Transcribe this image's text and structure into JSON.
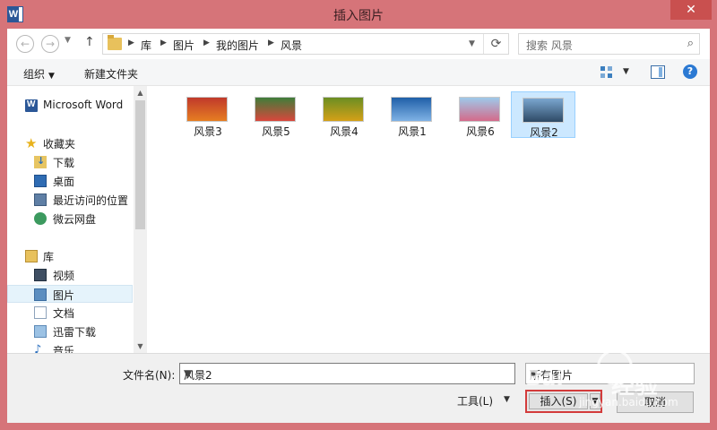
{
  "window": {
    "title": "插入图片",
    "close_glyph": "✕"
  },
  "nav": {
    "back_glyph": "←",
    "forward_glyph": "→",
    "up_glyph": "↑",
    "breadcrumbs": [
      "库",
      "图片",
      "我的图片",
      "风景"
    ],
    "refresh_glyph": "⟳",
    "search_placeholder": "搜索 风景",
    "search_glyph": "⌕"
  },
  "toolbar": {
    "organize_label": "组织",
    "new_folder_label": "新建文件夹",
    "help_glyph": "?"
  },
  "sidebar": {
    "items": [
      {
        "label": "Microsoft Word",
        "icon": "word-icon"
      },
      {
        "label": "收藏夹",
        "icon": "star-icon"
      },
      {
        "label": "下载",
        "icon": "downloads-icon"
      },
      {
        "label": "桌面",
        "icon": "desktop-icon"
      },
      {
        "label": "最近访问的位置",
        "icon": "recent-places-icon"
      },
      {
        "label": "微云网盘",
        "icon": "cloud-drive-icon"
      },
      {
        "label": "库",
        "icon": "library-icon"
      },
      {
        "label": "视频",
        "icon": "video-icon"
      },
      {
        "label": "图片",
        "icon": "pictures-icon",
        "selected": true
      },
      {
        "label": "文档",
        "icon": "documents-icon"
      },
      {
        "label": "迅雷下载",
        "icon": "thunder-download-icon"
      },
      {
        "label": "音乐",
        "icon": "music-icon"
      }
    ]
  },
  "files": [
    {
      "name": "风景3",
      "colors": [
        "#c0392b",
        "#e67e22"
      ]
    },
    {
      "name": "风景5",
      "colors": [
        "#3f7d3a",
        "#d9473c"
      ]
    },
    {
      "name": "风景4",
      "colors": [
        "#6b8e23",
        "#d4a017"
      ]
    },
    {
      "name": "风景1",
      "colors": [
        "#1f5fa8",
        "#7fb2e5"
      ]
    },
    {
      "name": "风景6",
      "colors": [
        "#9ec9ea",
        "#d46a8a"
      ]
    },
    {
      "name": "风景2",
      "colors": [
        "#7aa6cf",
        "#2e4a66"
      ],
      "selected": true
    }
  ],
  "footer": {
    "filename_label": "文件名(N):",
    "filename_value": "风景2",
    "filetype_value": "所有图片",
    "tools_label": "工具(L)",
    "insert_label": "插入(S)",
    "cancel_label": "取消"
  },
  "watermark": {
    "bai": "Bai",
    "text": "经验",
    "url": "jingyan.baidu.com"
  },
  "colors": {
    "window_frame": "#d67479",
    "selection": "#cce8ff",
    "highlight_border": "#d33b3b"
  }
}
